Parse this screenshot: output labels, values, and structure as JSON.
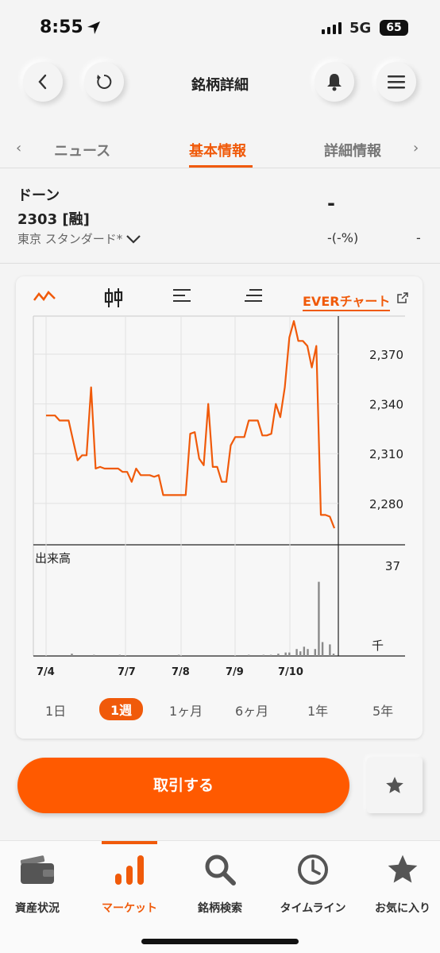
{
  "status_bar": {
    "time": "8:55",
    "network": "5G",
    "battery": "65"
  },
  "header": {
    "title": "銘柄詳細"
  },
  "tabs": [
    {
      "label": "ニュース",
      "active": false
    },
    {
      "label": "基本情報",
      "active": true
    },
    {
      "label": "詳細情報",
      "active": false
    }
  ],
  "stock": {
    "name": "ドーン",
    "code": "2303 [融]",
    "market": "東京 スタンダード*",
    "price": "-",
    "change": "-(-%)",
    "change2": "-"
  },
  "chart_toolbar": {
    "ever_label": "EVERチャート"
  },
  "chart_data": {
    "type": "line",
    "x_tick_labels": [
      "7/4",
      "7/7",
      "7/8",
      "7/9",
      "7/10"
    ],
    "y_tick_labels": [
      "2,370",
      "2,340",
      "2,310",
      "2,280"
    ],
    "y_ticks": [
      2370,
      2340,
      2310,
      2280
    ],
    "ylim": [
      2255,
      2393
    ],
    "grid": true,
    "price_series": [
      2333,
      2333,
      2333,
      2330,
      2330,
      2330,
      2318,
      2306,
      2309,
      2309,
      2350,
      2301,
      2302,
      2301,
      2301,
      2301,
      2301,
      2299,
      2299,
      2293,
      2301,
      2297,
      2297,
      2297,
      2296,
      2297,
      2285,
      2285,
      2285,
      2285,
      2285,
      2285,
      2322,
      2323,
      2307,
      2303,
      2340,
      2302,
      2302,
      2293,
      2293,
      2315,
      2320,
      2320,
      2320,
      2330,
      2330,
      2330,
      2321,
      2321,
      2322,
      2340,
      2332,
      2350,
      2380,
      2390,
      2378,
      2378,
      2375,
      2362,
      2375,
      2273,
      2273,
      2272,
      2265
    ],
    "volume": {
      "label": "出来高",
      "max_label": "37",
      "unit": "千",
      "max": 37,
      "bars": [
        0,
        0,
        0,
        0,
        0,
        0,
        0,
        1,
        0,
        0,
        0,
        0,
        0,
        0.5,
        0,
        0,
        0,
        0,
        0,
        0,
        0.5,
        0,
        0,
        0,
        0,
        0,
        0,
        0,
        0,
        0,
        0,
        0,
        0,
        0,
        0,
        0,
        0.5,
        0,
        0,
        0,
        0,
        0,
        0,
        0,
        0,
        0,
        0,
        0,
        0,
        0,
        0,
        0,
        0,
        0,
        0,
        0.5,
        0,
        0,
        0,
        0.5,
        0,
        0.5,
        0,
        1,
        0,
        1.5,
        1.5,
        0,
        3,
        2,
        4,
        3,
        0,
        3,
        32,
        6,
        0,
        5,
        1
      ]
    }
  },
  "periods": [
    {
      "label": "1日",
      "active": false
    },
    {
      "label": "1週",
      "active": true
    },
    {
      "label": "1ヶ月",
      "active": false
    },
    {
      "label": "6ヶ月",
      "active": false
    },
    {
      "label": "1年",
      "active": false
    },
    {
      "label": "5年",
      "active": false
    }
  ],
  "actions": {
    "trade_label": "取引する"
  },
  "bottom_nav": [
    {
      "label": "資産状況",
      "icon": "wallet-icon",
      "active": false
    },
    {
      "label": "マーケット",
      "icon": "bar-chart-icon",
      "active": true
    },
    {
      "label": "銘柄検索",
      "icon": "search-icon",
      "active": false
    },
    {
      "label": "タイムライン",
      "icon": "clock-icon",
      "active": false
    },
    {
      "label": "お気に入り",
      "icon": "star-icon",
      "active": false
    }
  ],
  "colors": {
    "accent": "#f05a0a",
    "button": "#ff5a00",
    "volume_bar": "#8a8a8a",
    "grid": "#e2e2e2"
  }
}
